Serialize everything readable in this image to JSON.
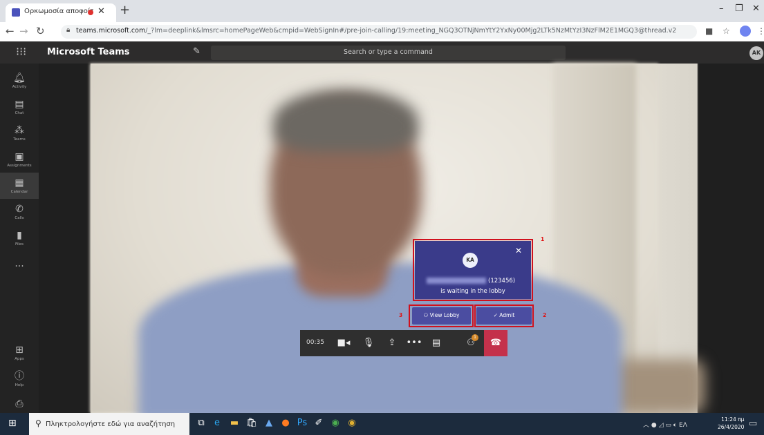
{
  "browser": {
    "tab_title": "Ορκωμοσία αποφοίτων του",
    "url_host": "teams.microsoft.com",
    "url_rest": "/_?lm=deeplink&lmsrc=homePageWeb&cmpid=WebSignIn#/pre-join-calling/19:meeting_NGQ3OTNjNmYtY2YxNy00Mjg2LTk5NzMtYzI3NzFlM2E1MGQ3@thread.v2"
  },
  "teams": {
    "app_name": "Microsoft Teams",
    "search_placeholder": "Search or type a command",
    "avatar_initials": "AK",
    "rail": [
      {
        "label": "Activity",
        "icon": "bell-icon"
      },
      {
        "label": "Chat",
        "icon": "chat-icon"
      },
      {
        "label": "Teams",
        "icon": "teams-icon"
      },
      {
        "label": "Assignments",
        "icon": "assignments-icon"
      },
      {
        "label": "Calendar",
        "icon": "calendar-icon"
      },
      {
        "label": "Calls",
        "icon": "phone-icon"
      },
      {
        "label": "Files",
        "icon": "file-icon"
      }
    ],
    "rail_bottom": [
      {
        "label": "Apps",
        "icon": "apps-icon"
      },
      {
        "label": "Help",
        "icon": "help-icon"
      }
    ]
  },
  "lobby": {
    "initials": "KA",
    "id_text": "(123456)",
    "message": "is waiting in the lobby",
    "view_lobby_label": "View Lobby",
    "admit_label": "Admit",
    "annotations": [
      "1",
      "2",
      "3"
    ]
  },
  "call": {
    "timer": "00:35",
    "participants_badge": "1"
  },
  "taskbar": {
    "search_placeholder": "Πληκτρολογήστε εδώ για αναζήτηση",
    "language": "ΕΛ",
    "time": "11:24 πμ",
    "date": "26/4/2020"
  }
}
